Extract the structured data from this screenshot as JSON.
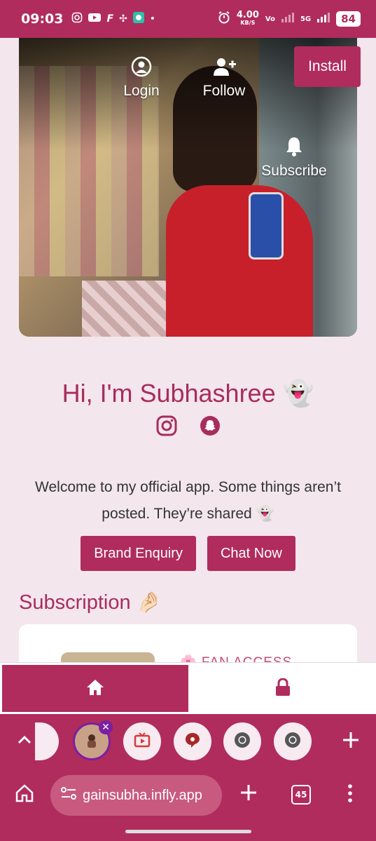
{
  "status_bar": {
    "time": "09:03",
    "network_speed": "4.00",
    "network_unit": "KB/S",
    "volte": "Vo",
    "signal_label": "5G",
    "battery": "84"
  },
  "hero": {
    "login_label": "Login",
    "follow_label": "Follow",
    "subscribe_label": "Subscribe",
    "install_label": "Install"
  },
  "profile": {
    "greeting": "Hi, I'm Subhashree 👻",
    "welcome_text": "Welcome to my official app. Some things aren’t posted. They’re shared 👻",
    "brand_enquiry_label": "Brand Enquiry",
    "chat_now_label": "Chat Now"
  },
  "subscription": {
    "title": "Subscription 🤌🏻",
    "plan_label": "🌸 FAN ACCESS"
  },
  "browser": {
    "url": "gainsubha.infly.app",
    "tab_count": "45"
  },
  "colors": {
    "brand": "#b02c5c",
    "background": "#f3e6ec",
    "accent_text": "#a82d5b"
  }
}
